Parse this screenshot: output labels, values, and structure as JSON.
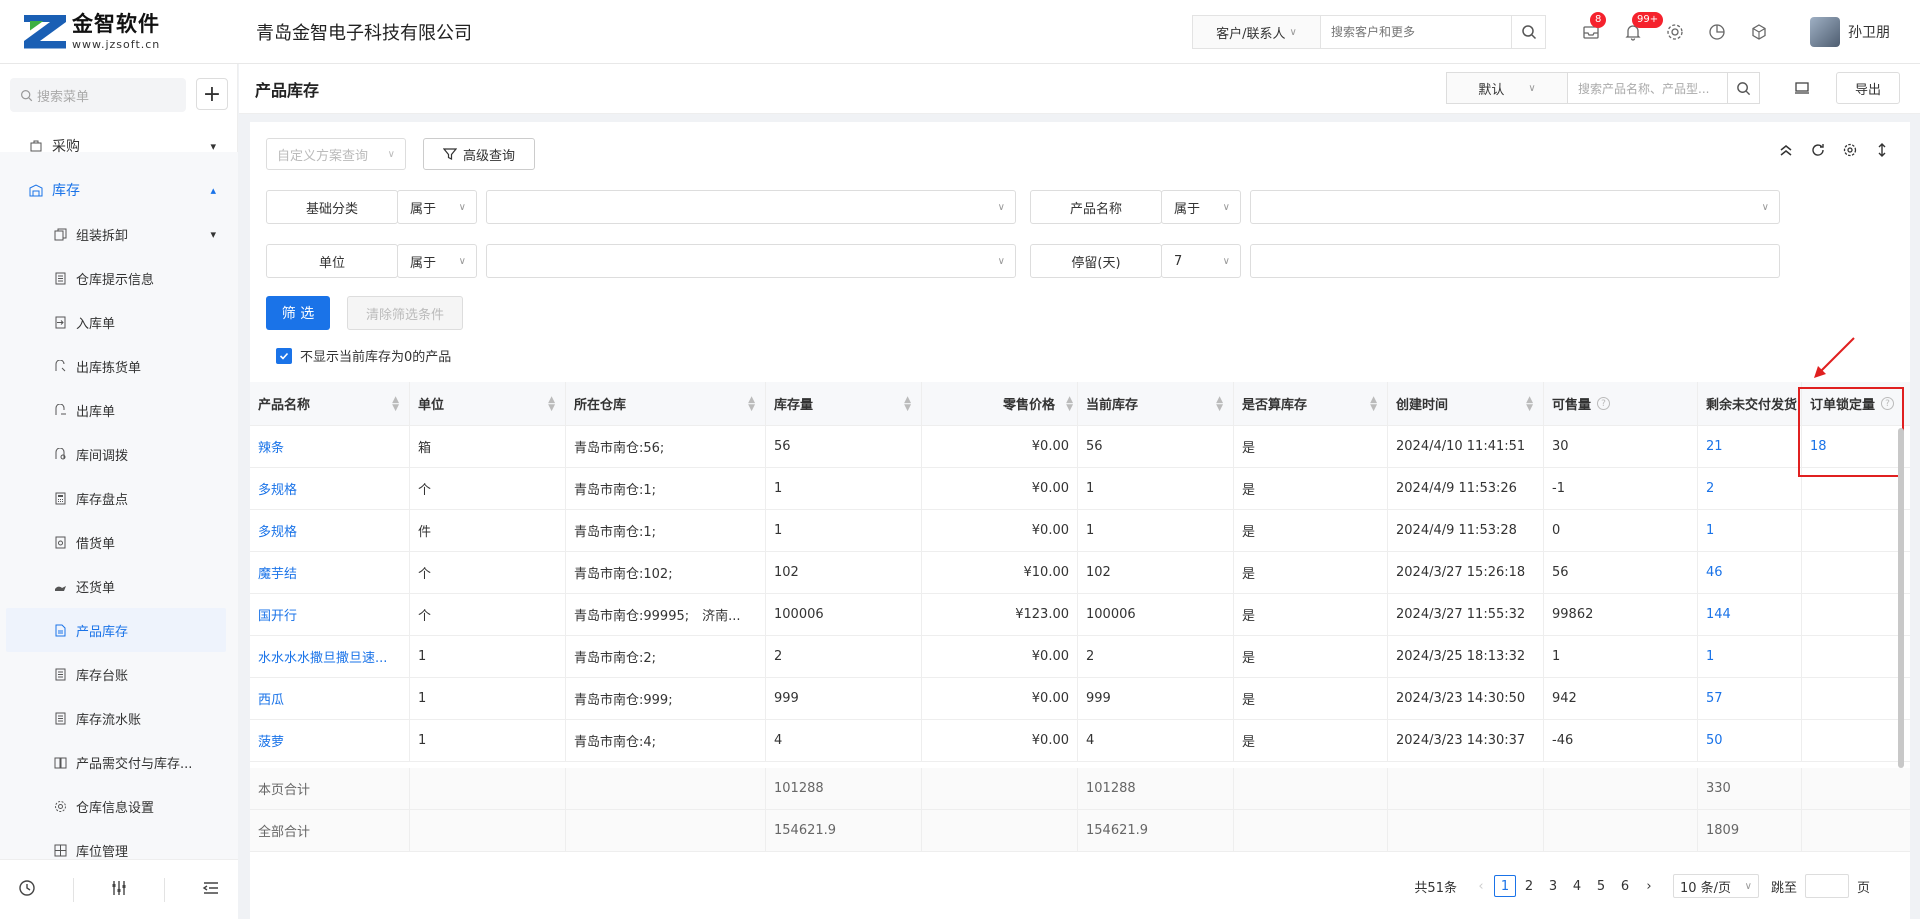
{
  "header": {
    "logo_cn": "金智软件",
    "logo_en": "www.jzsoft.cn",
    "company": "青岛金智电子科技有限公司",
    "search_type": "客户/联系人",
    "search_placeholder": "搜索客户和更多",
    "badge_messages": "8",
    "badge_notifications": "99+",
    "username": "孙卫朋"
  },
  "sidebar": {
    "search_placeholder": "搜索菜单",
    "items": [
      {
        "label": "采购",
        "icon": "bag-icon"
      },
      {
        "label": "库存",
        "icon": "warehouse-icon"
      },
      {
        "label": "组装拆卸",
        "icon": "copy-icon"
      },
      {
        "label": "仓库提示信息",
        "icon": "list-icon"
      },
      {
        "label": "入库单",
        "icon": "inbound-icon"
      },
      {
        "label": "出库拣货单",
        "icon": "pick-icon"
      },
      {
        "label": "出库单",
        "icon": "outbound-icon"
      },
      {
        "label": "库间调拨",
        "icon": "transfer-icon"
      },
      {
        "label": "库存盘点",
        "icon": "calculator-icon"
      },
      {
        "label": "借货单",
        "icon": "borrow-icon"
      },
      {
        "label": "还货单",
        "icon": "return-icon"
      },
      {
        "label": "产品库存",
        "icon": "document-icon"
      },
      {
        "label": "库存台账",
        "icon": "ledger-icon"
      },
      {
        "label": "库存流水账",
        "icon": "journal-icon"
      },
      {
        "label": "产品需交付与库存...",
        "icon": "book-icon"
      },
      {
        "label": "仓库信息设置",
        "icon": "gear-icon"
      },
      {
        "label": "库位管理",
        "icon": "grid-icon"
      }
    ]
  },
  "page": {
    "title": "产品库存",
    "view_select": "默认",
    "search_placeholder": "搜索产品名称、产品型...",
    "export": "导出"
  },
  "filters": {
    "scheme_placeholder": "自定义方案查询",
    "advanced": "高级查询",
    "row1": {
      "label1": "基础分类",
      "op1": "属于",
      "label2": "产品名称",
      "op2": "属于"
    },
    "row2": {
      "label1": "单位",
      "op1": "属于",
      "label2": "停留(天)",
      "op2": "7"
    },
    "apply": "筛 选",
    "clear": "清除筛选条件",
    "hide_zero": "不显示当前库存为0的产品"
  },
  "table": {
    "columns": [
      "产品名称",
      "单位",
      "所在仓库",
      "库存量",
      "零售价格",
      "当前库存",
      "是否算库存",
      "创建时间",
      "可售量",
      "剩余未交付发货",
      "订单锁定量"
    ],
    "rows": [
      [
        "辣条",
        "箱",
        "青岛市南仓:56;",
        "56",
        "¥0.00",
        "56",
        "是",
        "2024/4/10 11:41:51",
        "30",
        "21",
        "18"
      ],
      [
        "多规格",
        "个",
        "青岛市南仓:1;",
        "1",
        "¥0.00",
        "1",
        "是",
        "2024/4/9 11:53:26",
        "-1",
        "2",
        ""
      ],
      [
        "多规格",
        "件",
        "青岛市南仓:1;",
        "1",
        "¥0.00",
        "1",
        "是",
        "2024/4/9 11:53:28",
        "0",
        "1",
        ""
      ],
      [
        "魔芋结",
        "个",
        "青岛市南仓:102;",
        "102",
        "¥10.00",
        "102",
        "是",
        "2024/3/27 15:26:18",
        "56",
        "46",
        ""
      ],
      [
        "国开行",
        "个",
        "青岛市南仓:99995;　济南...",
        "100006",
        "¥123.00",
        "100006",
        "是",
        "2024/3/27 11:55:32",
        "99862",
        "144",
        ""
      ],
      [
        "水水水水撒旦撒旦速...",
        "1",
        "青岛市南仓:2;",
        "2",
        "¥0.00",
        "2",
        "是",
        "2024/3/25 18:13:32",
        "1",
        "1",
        ""
      ],
      [
        "西瓜",
        "1",
        "青岛市南仓:999;",
        "999",
        "¥0.00",
        "999",
        "是",
        "2024/3/23 14:30:50",
        "942",
        "57",
        ""
      ],
      [
        "菠萝",
        "1",
        "青岛市南仓:4;",
        "4",
        "¥0.00",
        "4",
        "是",
        "2024/3/23 14:30:37",
        "-46",
        "50",
        ""
      ]
    ],
    "totals": [
      {
        "label": "本页合计",
        "stock": "101288",
        "current": "101288",
        "remaining": "330"
      },
      {
        "label": "全部合计",
        "stock": "154621.9",
        "current": "154621.9",
        "remaining": "1809"
      }
    ]
  },
  "pagination": {
    "total": "共51条",
    "pages": [
      "1",
      "2",
      "3",
      "4",
      "5",
      "6"
    ],
    "page_size": "10 条/页",
    "jump_label": "跳至",
    "page_suffix": "页"
  }
}
